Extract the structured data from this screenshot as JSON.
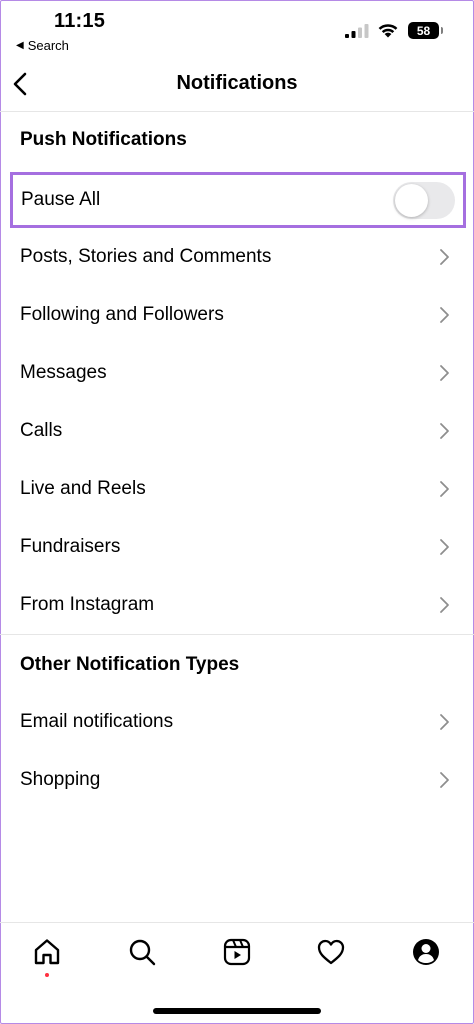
{
  "status_bar": {
    "time": "11:15",
    "back_app": "Search",
    "battery": "58"
  },
  "nav": {
    "title": "Notifications"
  },
  "push_section": {
    "title": "Push Notifications",
    "pause_all": {
      "label": "Pause All",
      "enabled": false
    },
    "items": [
      {
        "label": "Posts, Stories and Comments"
      },
      {
        "label": "Following and Followers"
      },
      {
        "label": "Messages"
      },
      {
        "label": "Calls"
      },
      {
        "label": "Live and Reels"
      },
      {
        "label": "Fundraisers"
      },
      {
        "label": "From Instagram"
      }
    ]
  },
  "other_section": {
    "title": "Other Notification Types",
    "items": [
      {
        "label": "Email notifications"
      },
      {
        "label": "Shopping"
      }
    ]
  },
  "tab_bar": {
    "tabs": [
      {
        "icon": "home-icon",
        "active": true
      },
      {
        "icon": "search-icon"
      },
      {
        "icon": "reels-icon"
      },
      {
        "icon": "heart-icon"
      },
      {
        "icon": "profile-icon"
      }
    ]
  },
  "colors": {
    "highlight": "#a56fe0",
    "toggle_off": "#e9e9eb",
    "notification_dot": "#ff3040"
  }
}
